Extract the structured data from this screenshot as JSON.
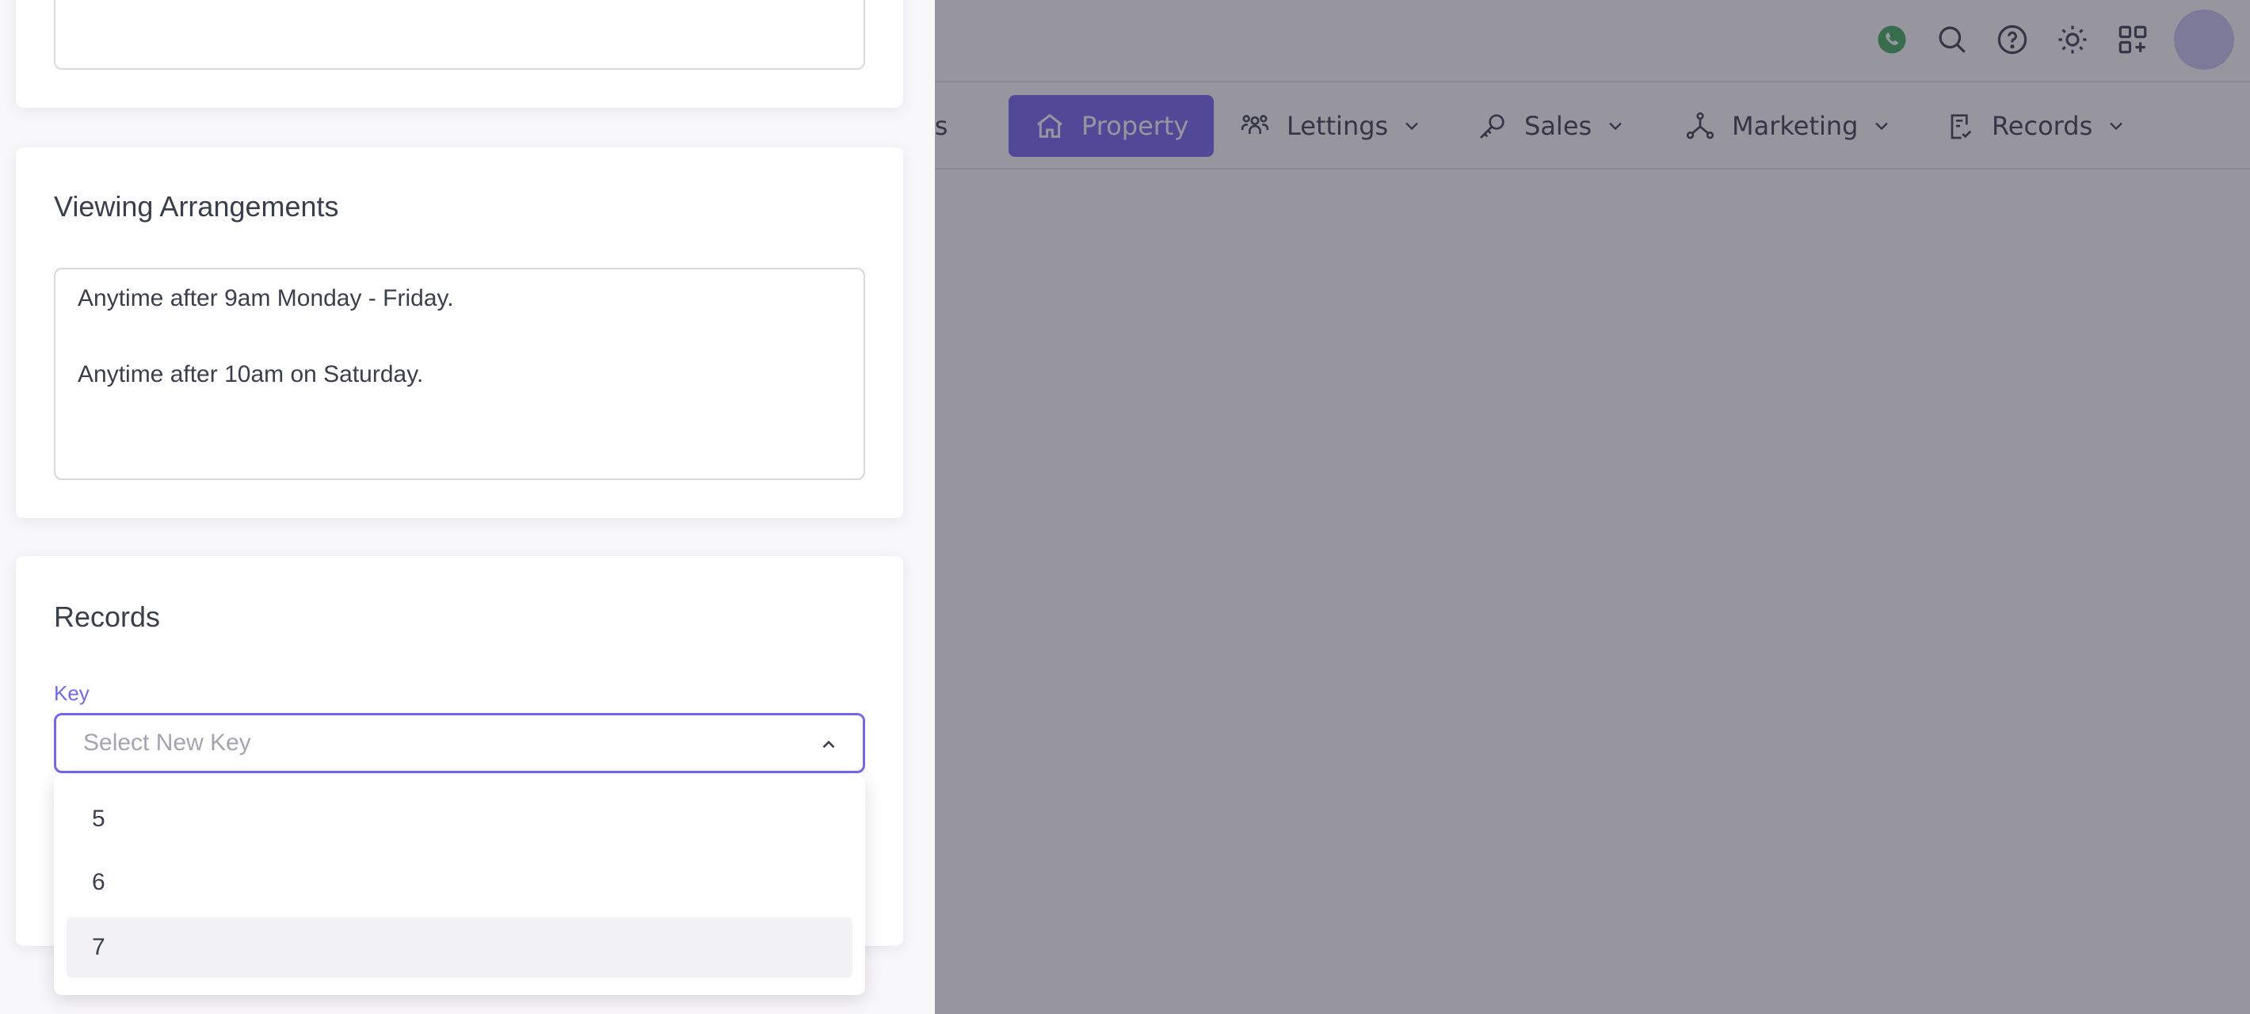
{
  "nav": {
    "items": [
      {
        "label": "acts",
        "icon": "contacts-icon"
      },
      {
        "label": "Property",
        "icon": "home-icon",
        "active": true
      },
      {
        "label": "Lettings",
        "icon": "users-icon"
      },
      {
        "label": "Sales",
        "icon": "key-icon"
      },
      {
        "label": "Marketing",
        "icon": "hierarchy-icon"
      },
      {
        "label": "Records",
        "icon": "clipboard-check-icon"
      }
    ]
  },
  "topbar": {
    "icons": [
      "whatsapp-icon",
      "search-icon",
      "help-icon",
      "sun-icon",
      "apps-add-icon",
      "avatar"
    ],
    "whatsapp_color": "#3fae5a"
  },
  "colors": {
    "accent": "#7367f0",
    "overlay": "rgba(47,43,61,0.5)"
  },
  "drawer": {
    "viewing": {
      "title": "Viewing Arrangements",
      "lines": [
        "Anytime after 9am Monday - Friday.",
        "Anytime after 10am on Saturday."
      ]
    },
    "records": {
      "title": "Records",
      "key_label": "Key",
      "key_placeholder": "Select New Key",
      "options": [
        "5",
        "6",
        "7"
      ],
      "highlighted_option": "7"
    }
  }
}
